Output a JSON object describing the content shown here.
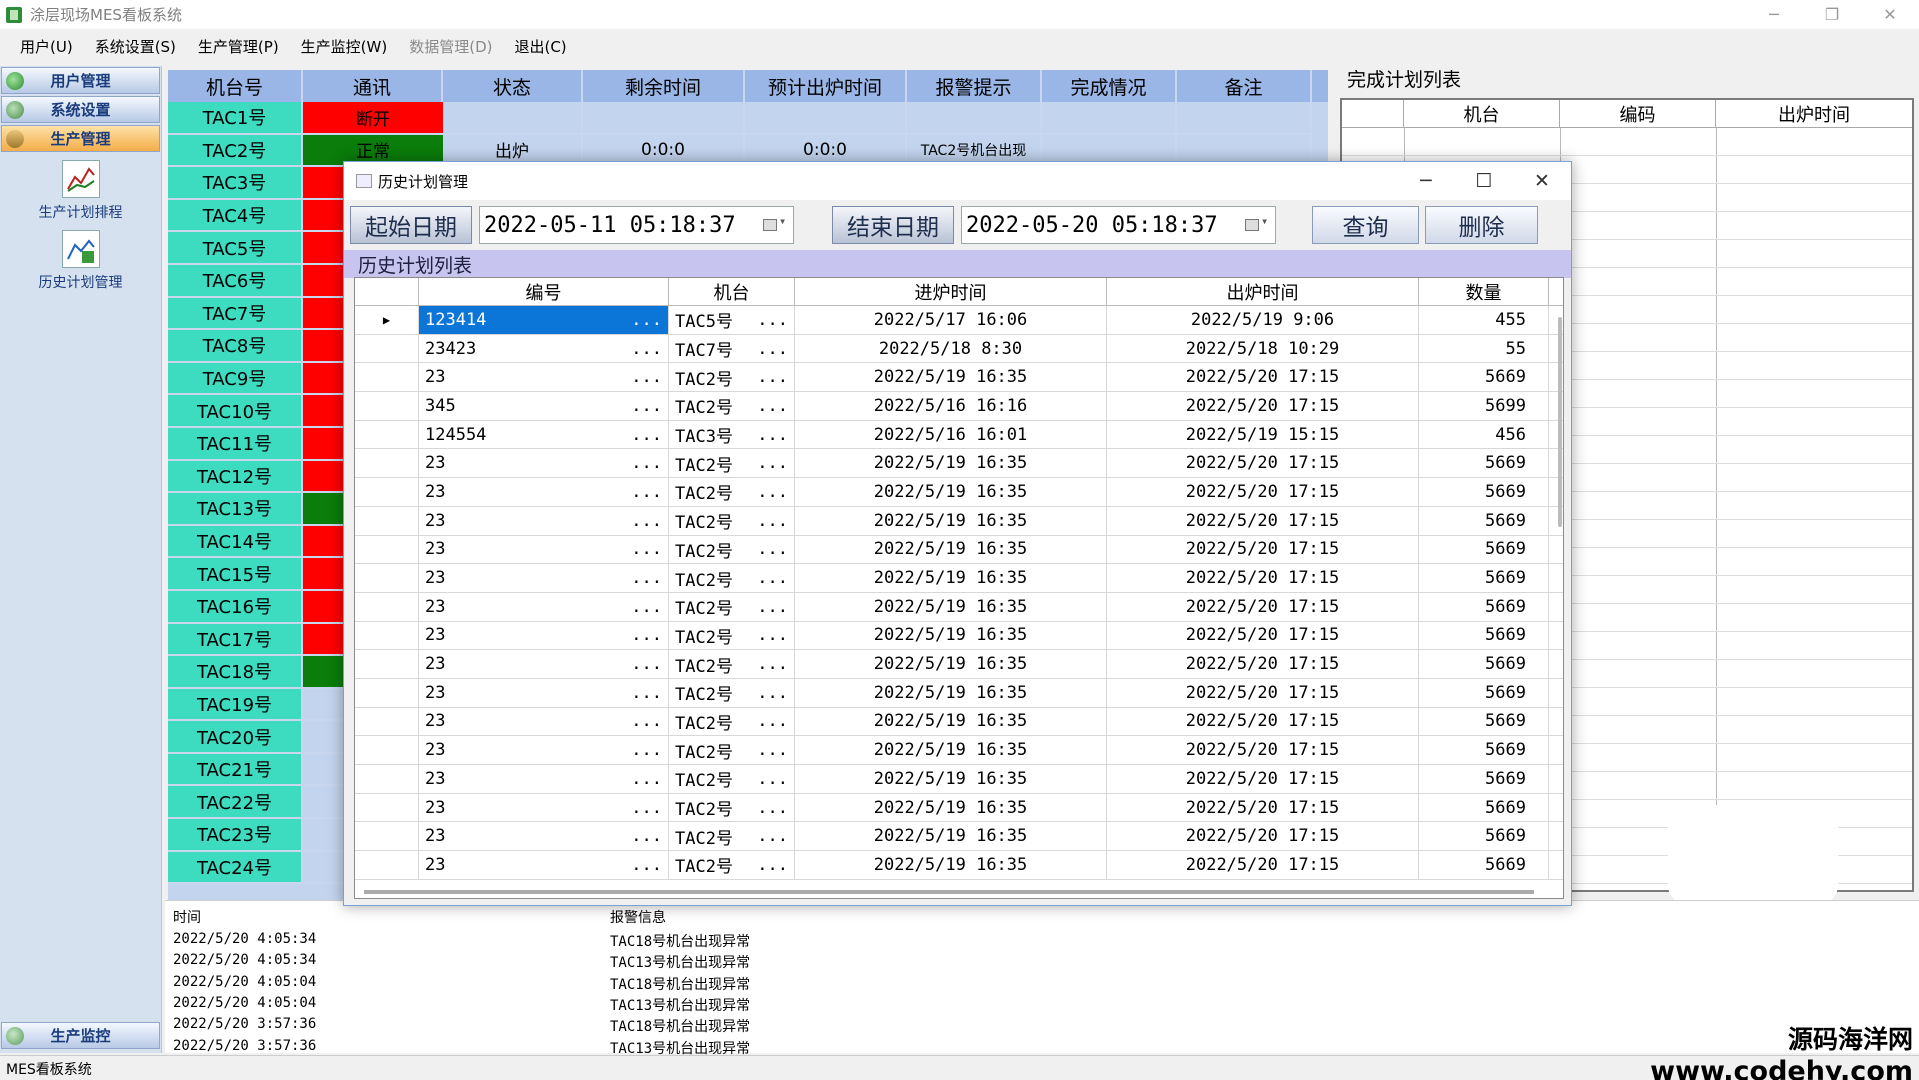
{
  "app": {
    "title": "涂层现场MES看板系统",
    "status": "MES看板系统"
  },
  "window_controls": {
    "min": "─",
    "max": "❐",
    "close": "✕"
  },
  "menu": [
    {
      "label": "用户(U)",
      "disabled": false
    },
    {
      "label": "系统设置(S)",
      "disabled": false
    },
    {
      "label": "生产管理(P)",
      "disabled": false
    },
    {
      "label": "生产监控(W)",
      "disabled": false
    },
    {
      "label": "数据管理(D)",
      "disabled": true
    },
    {
      "label": "退出(C)",
      "disabled": false
    }
  ],
  "sidebar": {
    "nav": [
      "用户管理",
      "系统设置",
      "生产管理"
    ],
    "items": [
      "生产计划排程",
      "历史计划管理"
    ],
    "bottom": "生产监控"
  },
  "grid": {
    "headers": [
      "机台号",
      "通讯",
      "状态",
      "剩余时间",
      "预计出炉时间",
      "报警提示",
      "完成情况",
      "备注"
    ],
    "rows": [
      {
        "machine": "TAC1号",
        "comm": "断开",
        "comm_state": "red",
        "status": "",
        "remaining": "",
        "eta": "",
        "alarm": ""
      },
      {
        "machine": "TAC2号",
        "comm": "正常",
        "comm_state": "green",
        "status": "出炉",
        "remaining": "0:0:0",
        "eta": "0:0:0",
        "alarm": "TAC2号机台出现"
      },
      {
        "machine": "TAC3号",
        "comm": "",
        "comm_state": "red"
      },
      {
        "machine": "TAC4号",
        "comm": "",
        "comm_state": "red"
      },
      {
        "machine": "TAC5号",
        "comm": "",
        "comm_state": "red"
      },
      {
        "machine": "TAC6号",
        "comm": "",
        "comm_state": "red"
      },
      {
        "machine": "TAC7号",
        "comm": "",
        "comm_state": "red"
      },
      {
        "machine": "TAC8号",
        "comm": "",
        "comm_state": "red"
      },
      {
        "machine": "TAC9号",
        "comm": "",
        "comm_state": "red"
      },
      {
        "machine": "TAC10号",
        "comm": "",
        "comm_state": "red"
      },
      {
        "machine": "TAC11号",
        "comm": "",
        "comm_state": "red"
      },
      {
        "machine": "TAC12号",
        "comm": "",
        "comm_state": "red"
      },
      {
        "machine": "TAC13号",
        "comm": "",
        "comm_state": "green"
      },
      {
        "machine": "TAC14号",
        "comm": "",
        "comm_state": "red"
      },
      {
        "machine": "TAC15号",
        "comm": "",
        "comm_state": "red"
      },
      {
        "machine": "TAC16号",
        "comm": "",
        "comm_state": "red"
      },
      {
        "machine": "TAC17号",
        "comm": "",
        "comm_state": "red"
      },
      {
        "machine": "TAC18号",
        "comm": "",
        "comm_state": "green"
      },
      {
        "machine": "TAC19号",
        "comm": "",
        "comm_state": "blank"
      },
      {
        "machine": "TAC20号",
        "comm": "",
        "comm_state": "blank"
      },
      {
        "machine": "TAC21号",
        "comm": "",
        "comm_state": "blank"
      },
      {
        "machine": "TAC22号",
        "comm": "",
        "comm_state": "blank"
      },
      {
        "machine": "TAC23号",
        "comm": "",
        "comm_state": "blank"
      },
      {
        "machine": "TAC24号",
        "comm": "",
        "comm_state": "blank"
      }
    ]
  },
  "done": {
    "title": "完成计划列表",
    "headers": [
      "",
      "机台",
      "编码",
      "出炉时间"
    ]
  },
  "log": {
    "headers": [
      "时间",
      "报警信息"
    ],
    "rows": [
      {
        "time": "2022/5/20 4:05:34",
        "msg": "TAC18号机台出现异常"
      },
      {
        "time": "2022/5/20 4:05:34",
        "msg": "TAC13号机台出现异常"
      },
      {
        "time": "2022/5/20 4:05:04",
        "msg": "TAC18号机台出现异常"
      },
      {
        "time": "2022/5/20 4:05:04",
        "msg": "TAC13号机台出现异常"
      },
      {
        "time": "2022/5/20 3:57:36",
        "msg": "TAC18号机台出现异常"
      },
      {
        "time": "2022/5/20 3:57:36",
        "msg": "TAC13号机台出现异常"
      }
    ]
  },
  "dialog": {
    "title": "历史计划管理",
    "controls": {
      "min": "─",
      "max": "☐",
      "close": "✕"
    },
    "start_label": "起始日期",
    "start_value": "2022-05-11  05:18:37",
    "end_label": "结束日期",
    "end_value": "2022-05-20  05:18:37",
    "query": "查询",
    "delete": "删除",
    "list_title": "历史计划列表",
    "headers": [
      "",
      "编号",
      "机台",
      "进炉时间",
      "出炉时间",
      "数量"
    ],
    "rows": [
      {
        "code": "123414",
        "machine": "TAC5号",
        "in": "2022/5/17 16:06",
        "out": "2022/5/19 9:06",
        "qty": "455"
      },
      {
        "code": "23423",
        "machine": "TAC7号",
        "in": "2022/5/18 8:30",
        "out": "2022/5/18 10:29",
        "qty": "55"
      },
      {
        "code": "23",
        "machine": "TAC2号",
        "in": "2022/5/19 16:35",
        "out": "2022/5/20 17:15",
        "qty": "5669"
      },
      {
        "code": "345",
        "machine": "TAC2号",
        "in": "2022/5/16 16:16",
        "out": "2022/5/20 17:15",
        "qty": "5699"
      },
      {
        "code": "124554",
        "machine": "TAC3号",
        "in": "2022/5/16 16:01",
        "out": "2022/5/19 15:15",
        "qty": "456"
      },
      {
        "code": "23",
        "machine": "TAC2号",
        "in": "2022/5/19 16:35",
        "out": "2022/5/20 17:15",
        "qty": "5669"
      },
      {
        "code": "23",
        "machine": "TAC2号",
        "in": "2022/5/19 16:35",
        "out": "2022/5/20 17:15",
        "qty": "5669"
      },
      {
        "code": "23",
        "machine": "TAC2号",
        "in": "2022/5/19 16:35",
        "out": "2022/5/20 17:15",
        "qty": "5669"
      },
      {
        "code": "23",
        "machine": "TAC2号",
        "in": "2022/5/19 16:35",
        "out": "2022/5/20 17:15",
        "qty": "5669"
      },
      {
        "code": "23",
        "machine": "TAC2号",
        "in": "2022/5/19 16:35",
        "out": "2022/5/20 17:15",
        "qty": "5669"
      },
      {
        "code": "23",
        "machine": "TAC2号",
        "in": "2022/5/19 16:35",
        "out": "2022/5/20 17:15",
        "qty": "5669"
      },
      {
        "code": "23",
        "machine": "TAC2号",
        "in": "2022/5/19 16:35",
        "out": "2022/5/20 17:15",
        "qty": "5669"
      },
      {
        "code": "23",
        "machine": "TAC2号",
        "in": "2022/5/19 16:35",
        "out": "2022/5/20 17:15",
        "qty": "5669"
      },
      {
        "code": "23",
        "machine": "TAC2号",
        "in": "2022/5/19 16:35",
        "out": "2022/5/20 17:15",
        "qty": "5669"
      },
      {
        "code": "23",
        "machine": "TAC2号",
        "in": "2022/5/19 16:35",
        "out": "2022/5/20 17:15",
        "qty": "5669"
      },
      {
        "code": "23",
        "machine": "TAC2号",
        "in": "2022/5/19 16:35",
        "out": "2022/5/20 17:15",
        "qty": "5669"
      },
      {
        "code": "23",
        "machine": "TAC2号",
        "in": "2022/5/19 16:35",
        "out": "2022/5/20 17:15",
        "qty": "5669"
      },
      {
        "code": "23",
        "machine": "TAC2号",
        "in": "2022/5/19 16:35",
        "out": "2022/5/20 17:15",
        "qty": "5669"
      },
      {
        "code": "23",
        "machine": "TAC2号",
        "in": "2022/5/19 16:35",
        "out": "2022/5/20 17:15",
        "qty": "5669"
      },
      {
        "code": "23",
        "machine": "TAC2号",
        "in": "2022/5/19 16:35",
        "out": "2022/5/20 17:15",
        "qty": "5669"
      }
    ]
  },
  "watermark": {
    "line1": "源码海洋网",
    "line2": "www.codehy.com"
  },
  "colors": {
    "red": "#ff0000",
    "green": "#0a7d0a",
    "teal": "#3ddcc0",
    "selected": "#0b76d8"
  }
}
